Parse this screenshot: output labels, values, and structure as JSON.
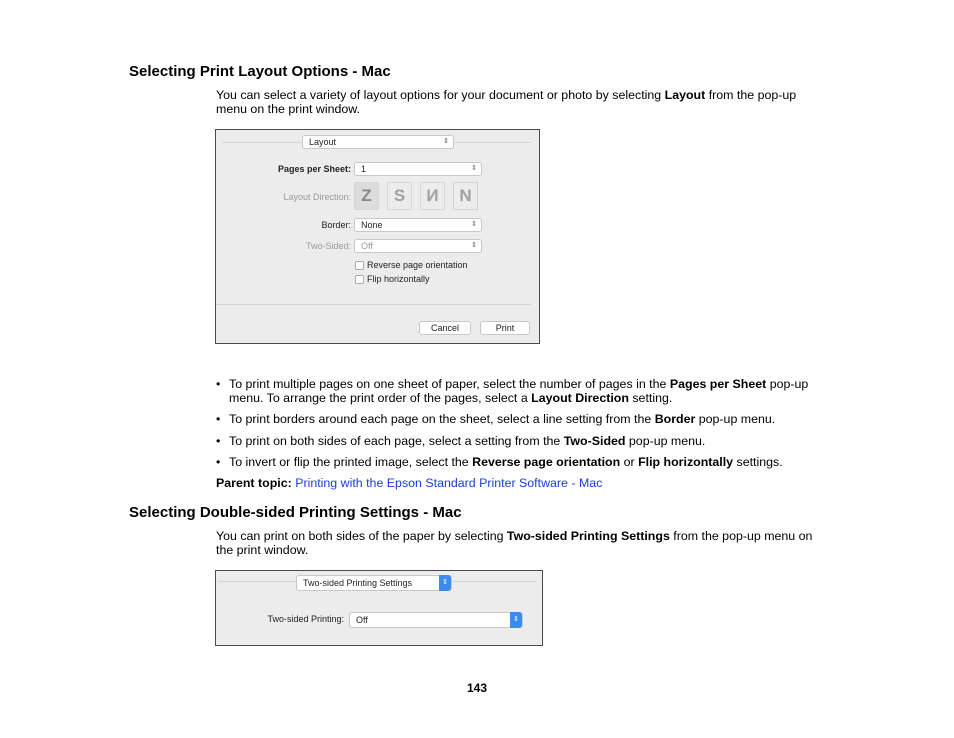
{
  "section1": {
    "heading": "Selecting Print Layout Options - Mac",
    "intro": {
      "pre": "You can select a variety of layout options for your document or photo by selecting ",
      "bold": "Layout",
      "post": " from the pop-up menu on the print window."
    },
    "dialog": {
      "panel_popup": "Layout",
      "pages_per_sheet_label": "Pages per Sheet:",
      "pages_per_sheet_value": "1",
      "layout_direction_label": "Layout Direction:",
      "layout_direction_options": [
        "Z",
        "S",
        "И",
        "N"
      ],
      "border_label": "Border:",
      "border_value": "None",
      "two_sided_label": "Two-Sided:",
      "two_sided_value": "Off",
      "reverse_orientation_label": "Reverse page orientation",
      "reverse_orientation_checked": false,
      "flip_horizontally_label": "Flip horizontally",
      "flip_horizontally_checked": false,
      "cancel_label": "Cancel",
      "print_label": "Print"
    },
    "bullets": [
      {
        "parts": [
          {
            "t": "To print multiple pages on one sheet of paper, select the number of pages in the "
          },
          {
            "b": "Pages per Sheet"
          },
          {
            "t": " pop-up menu. To arrange the print order of the pages, select a "
          },
          {
            "b": "Layout Direction"
          },
          {
            "t": " setting."
          }
        ]
      },
      {
        "parts": [
          {
            "t": "To print borders around each page on the sheet, select a line setting from the "
          },
          {
            "b": "Border"
          },
          {
            "t": " pop-up menu."
          }
        ]
      },
      {
        "parts": [
          {
            "t": "To print on both sides of each page, select a setting from the "
          },
          {
            "b": "Two-Sided"
          },
          {
            "t": " pop-up menu."
          }
        ]
      },
      {
        "parts": [
          {
            "t": "To invert or flip the printed image, select the "
          },
          {
            "b": "Reverse page orientation"
          },
          {
            "t": " or "
          },
          {
            "b": "Flip horizontally"
          },
          {
            "t": " settings."
          }
        ]
      }
    ],
    "parent_topic_label": "Parent topic:",
    "parent_topic_link": "Printing with the Epson Standard Printer Software - Mac"
  },
  "section2": {
    "heading": "Selecting Double-sided Printing Settings - Mac",
    "intro": {
      "pre": "You can print on both sides of the paper by selecting ",
      "bold": "Two-sided Printing Settings",
      "post": " from the pop-up menu on the print window."
    },
    "dialog": {
      "panel_popup": "Two-sided Printing Settings",
      "two_sided_printing_label": "Two-sided Printing:",
      "two_sided_printing_value": "Off"
    }
  },
  "page_number": "143",
  "colors": {
    "link": "#1a3fd6",
    "accent_blue": "#3b8cf0"
  }
}
